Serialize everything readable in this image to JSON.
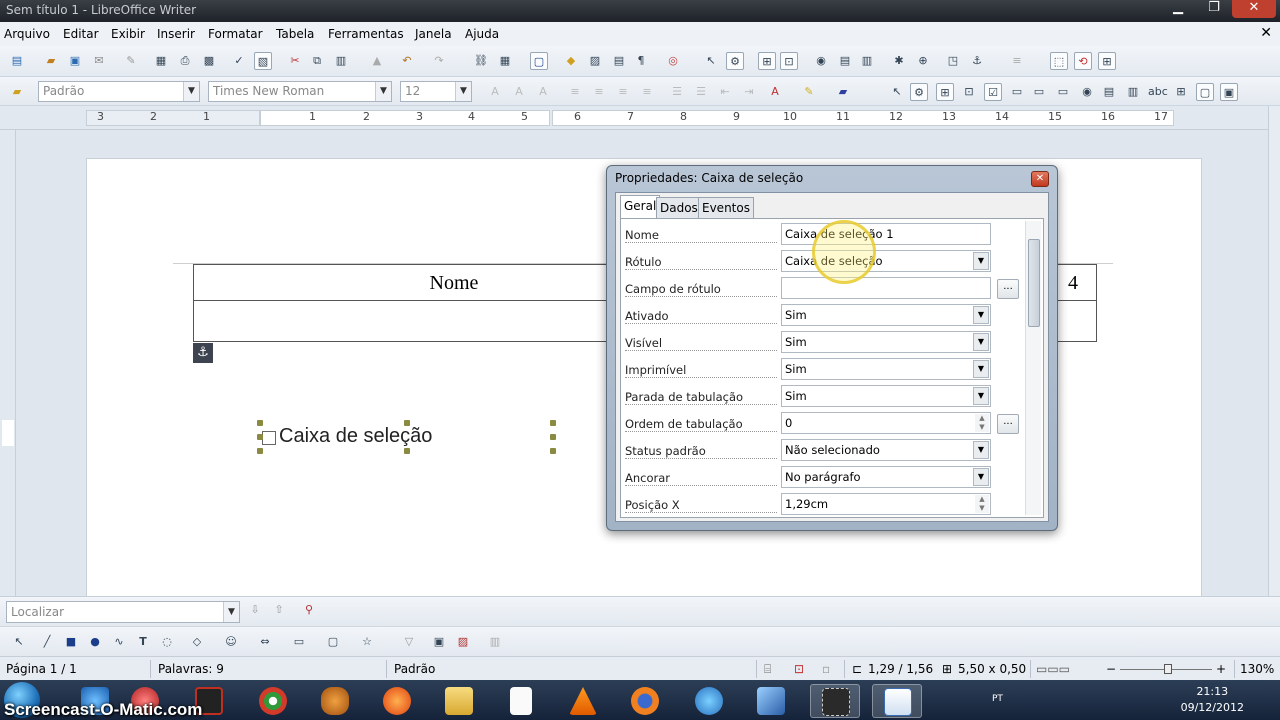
{
  "window": {
    "title": "Sem título 1 - LibreOffice Writer"
  },
  "menu": [
    "Arquivo",
    "Editar",
    "Exibir",
    "Inserir",
    "Formatar",
    "Tabela",
    "Ferramentas",
    "Janela",
    "Ajuda"
  ],
  "formatting": {
    "style": "Padrão",
    "font": "Times New Roman",
    "size": "12"
  },
  "ruler": [
    "3",
    "2",
    "1",
    "1",
    "2",
    "3",
    "4",
    "5",
    "6",
    "7",
    "8",
    "9",
    "10",
    "11",
    "12",
    "13",
    "14",
    "15",
    "16",
    "17"
  ],
  "document": {
    "table_header": "Nome",
    "table_right_cell": "4",
    "checkbox_label": "Caixa de seleção"
  },
  "dialog": {
    "title": "Propriedades: Caixa de seleção",
    "tabs": [
      "Geral",
      "Dados",
      "Eventos"
    ],
    "properties": [
      {
        "label": "Nome",
        "value": "Caixa de seleção 1"
      },
      {
        "label": "Rótulo",
        "value": "Caixa de seleção"
      },
      {
        "label": "Campo de rótulo",
        "value": ""
      },
      {
        "label": "Ativado",
        "value": "Sim"
      },
      {
        "label": "Visível",
        "value": "Sim"
      },
      {
        "label": "Imprimível",
        "value": "Sim"
      },
      {
        "label": "Parada de tabulação",
        "value": "Sim"
      },
      {
        "label": "Ordem de tabulação",
        "value": "0"
      },
      {
        "label": "Status padrão",
        "value": "Não selecionado"
      },
      {
        "label": "Ancorar",
        "value": "No parágrafo"
      },
      {
        "label": "Posição X",
        "value": "1,29cm"
      }
    ],
    "more_button": "..."
  },
  "find": {
    "placeholder": "Localizar"
  },
  "status": {
    "page": "Página 1 / 1",
    "words": "Palavras: 9",
    "style": "Padrão",
    "position": "1,29 / 1,56",
    "size": "5,50 x 0,50",
    "zoom": "130%"
  },
  "taskbar": {
    "watermark": "Screencast-O-Matic.com",
    "language": "PT",
    "time": "21:13",
    "date": "09/12/2012"
  },
  "icons": {
    "close": "close-icon",
    "minimize": "minimize-icon",
    "maximize": "maximize-icon",
    "dropdown": "chevron-down-icon",
    "anchor": "anchor-icon",
    "search": "search-icon"
  },
  "colors": {
    "dialog_frame": "#a2b3c6",
    "highlight": "#f0d840",
    "taskbar": "#15233a"
  }
}
